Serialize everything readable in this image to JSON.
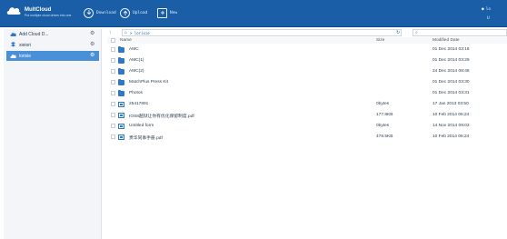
{
  "header": {
    "brand": "MultCloud",
    "tagline": "Put multiple cloud drives into one.",
    "buttons": {
      "download": "Download",
      "upload": "Upload",
      "new": "New"
    },
    "user": "lo",
    "user2": "U"
  },
  "sidebar": {
    "items": [
      {
        "label": "Add Cloud D...",
        "icon": "cloud-plus-icon"
      },
      {
        "label": "xieiori",
        "icon": "dropbox-icon"
      },
      {
        "label": "lorixie",
        "icon": "cloud-icon"
      }
    ],
    "active_index": 2
  },
  "toolbar": {
    "breadcrumb": "> lorixie"
  },
  "table": {
    "headers": {
      "name": "Name",
      "size": "Size",
      "modified": "Modified Date"
    },
    "rows": [
      {
        "name": "AMC",
        "size": "",
        "date": "01 Dec 2014 03:16",
        "type": "folder"
      },
      {
        "name": "AMC(1)",
        "size": "",
        "date": "01 Dec 2014 03:29",
        "type": "folder"
      },
      {
        "name": "AMC(2)",
        "size": "",
        "date": "24 Dec 2014 08:46",
        "type": "folder"
      },
      {
        "name": "MatchPlus Press Kit",
        "size": "",
        "date": "01 Dec 2014 03:30",
        "type": "folder"
      },
      {
        "name": "Photos",
        "size": "",
        "date": "01 Dec 2014 03:31",
        "type": "folder"
      },
      {
        "name": "25417891",
        "size": "0bytes",
        "date": "17 Jan 2013 03:50",
        "type": "file"
      },
      {
        "name": "IOS8越狱让你有优化保留制度.pdf",
        "size": "177.8KB",
        "date": "10 Feb 2014 06:24",
        "type": "file"
      },
      {
        "name": "Untitled form",
        "size": "0bytes",
        "date": "14 Nov 2014 09:03",
        "type": "file"
      },
      {
        "name": "贵华同事手册.pdf",
        "size": "478.5KB",
        "date": "10 Feb 2014 06:24",
        "type": "file"
      }
    ]
  },
  "colors": {
    "header_bg": "#1a5ea8",
    "active_bg": "#4a90d9",
    "folder": "#2f78c4"
  }
}
